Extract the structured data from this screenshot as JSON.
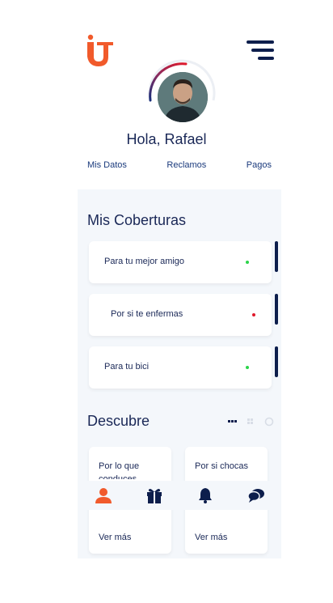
{
  "brand": {
    "logo_icon": "brand-logo-icon",
    "accent": "#f15a2b",
    "navy": "#0d1e4c"
  },
  "header": {
    "menu_icon": "menu-icon"
  },
  "profile": {
    "greeting": "Hola, Rafael"
  },
  "tabs": [
    {
      "label": "Mis Datos"
    },
    {
      "label": "Reclamos"
    },
    {
      "label": "Pagos"
    }
  ],
  "coverages": {
    "title": "Mis Coberturas",
    "items": [
      {
        "label": "Para tu mejor amigo",
        "status_color": "#2bd44a"
      },
      {
        "label": "Por si te enfermas",
        "status_color": "#e0192b"
      },
      {
        "label": "Para tu bici",
        "status_color": "#2bd44a"
      }
    ]
  },
  "discover": {
    "title": "Descubre",
    "cards": [
      {
        "title": "Por lo que conduces",
        "more": "Ver más"
      },
      {
        "title": "Por si chocas",
        "more": "Ver más"
      }
    ]
  },
  "bottom_nav": [
    {
      "icon": "user-icon",
      "active": true
    },
    {
      "icon": "gift-icon"
    },
    {
      "icon": "bell-icon"
    },
    {
      "icon": "chat-icon"
    }
  ]
}
